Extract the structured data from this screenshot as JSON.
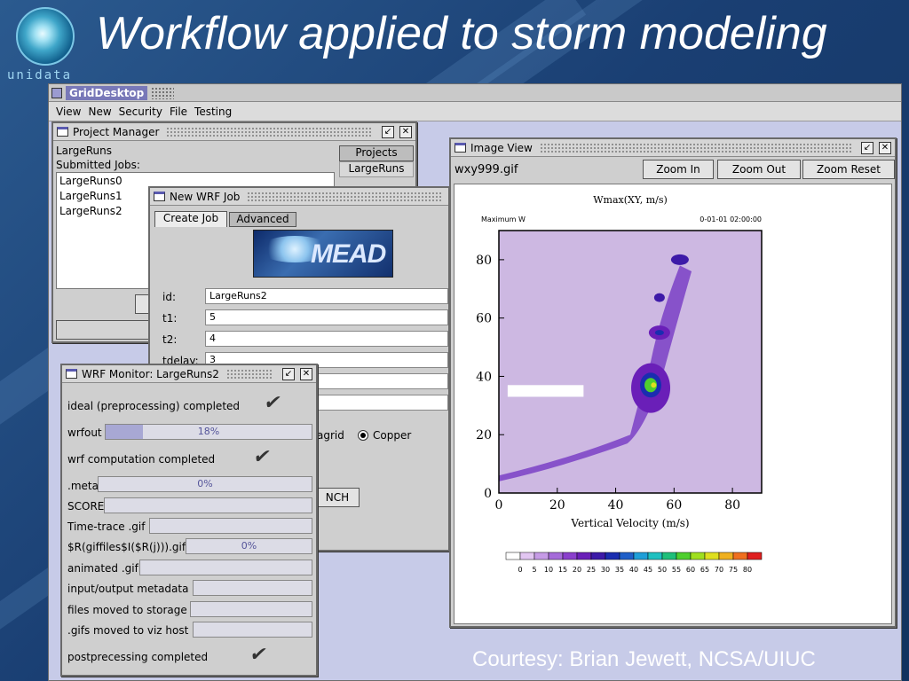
{
  "slide": {
    "title": "Workflow applied to storm modeling",
    "logo_text": "unidata",
    "courtesy": "Courtesy: Brian Jewett, NCSA/UIUC"
  },
  "desktop": {
    "title": "GridDesktop",
    "menu": [
      "View",
      "New",
      "Security",
      "File",
      "Testing"
    ]
  },
  "project_manager": {
    "title": "Project Manager",
    "project": "LargeRuns",
    "submitted_label": "Submitted Jobs:",
    "jobs": [
      "LargeRuns0",
      "LargeRuns1",
      "LargeRuns2"
    ],
    "tab_projects": "Projects",
    "tab_largeruns": "LargeRuns"
  },
  "new_job": {
    "title": "New WRF Job",
    "tab_create": "Create Job",
    "tab_advanced": "Advanced",
    "logo": "MEAD",
    "fields": [
      {
        "label": "id:",
        "value": "LargeRuns2"
      },
      {
        "label": "t1:",
        "value": "5"
      },
      {
        "label": "t2:",
        "value": "4"
      },
      {
        "label": "tdelay:",
        "value": "3"
      }
    ],
    "radio_a": "agrid",
    "radio_b": "Copper",
    "launch": "NCH"
  },
  "monitor": {
    "title": "WRF Monitor: LargeRuns2",
    "rows": [
      {
        "label": "ideal (preprocessing) completed",
        "type": "check"
      },
      {
        "label": "wrfout",
        "type": "progress",
        "value": "18%",
        "fraction": 0.18
      },
      {
        "label": "wrf computation completed",
        "type": "check"
      },
      {
        "label": ".meta",
        "type": "progress",
        "value": "0%",
        "fraction": 0
      },
      {
        "label": "SCORE",
        "type": "bar"
      },
      {
        "label": "Time-trace .gif",
        "type": "bar"
      },
      {
        "label": "$R(giffiles$I($R(j))).gif",
        "type": "progress",
        "value": "0%",
        "fraction": 0
      },
      {
        "label": "animated .gif",
        "type": "bar"
      },
      {
        "label": "input/output metadata",
        "type": "bar"
      },
      {
        "label": "files moved to storage",
        "type": "bar"
      },
      {
        "label": ".gifs moved to viz host",
        "type": "bar"
      },
      {
        "label": "postprecessing completed",
        "type": "check"
      }
    ]
  },
  "image_view": {
    "title": "Image View",
    "filename": "wxy999.gif",
    "zoom_in": "Zoom In",
    "zoom_out": "Zoom Out",
    "zoom_reset": "Zoom Reset"
  },
  "chart_data": {
    "type": "heatmap",
    "title": "Wmax(XY, m/s)",
    "subtitle_left": "Maximum W",
    "subtitle_right": "0-01-01 02:00:00",
    "xlabel": "Vertical Velocity (m/s)",
    "ylabel": "",
    "xlim": [
      0,
      90
    ],
    "ylim": [
      0,
      90
    ],
    "xticks": [
      0,
      20,
      40,
      60,
      80
    ],
    "yticks": [
      0,
      20,
      40,
      60,
      80
    ],
    "colorbar_ticks": [
      0,
      5,
      10,
      15,
      20,
      25,
      30,
      35,
      40,
      45,
      50,
      55,
      60,
      65,
      70,
      75,
      80
    ],
    "colorbar_colors": [
      "#ffffff",
      "#e2c6f2",
      "#c69be6",
      "#a56bd9",
      "#8a3fcc",
      "#6a1fb8",
      "#3d1aa8",
      "#1a2db0",
      "#1f5fc8",
      "#1f9fd8",
      "#1fc0c0",
      "#1fbf7a",
      "#4fcf2f",
      "#9fdf1f",
      "#dfdf1f",
      "#efb01f",
      "#ef6f1f",
      "#df1f1f"
    ],
    "background": "#cdb8e2"
  },
  "colors": {
    "accent": "#5a5ab0",
    "desktop_bg": "#c7cbe8"
  }
}
